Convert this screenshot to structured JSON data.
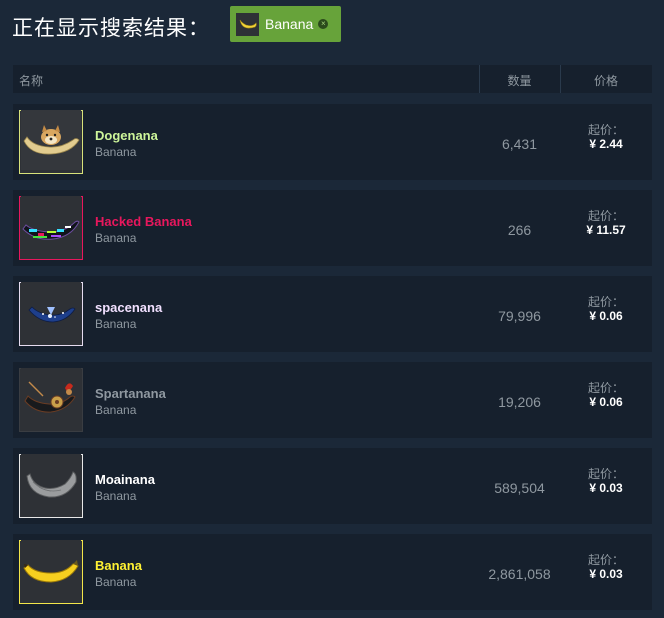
{
  "header": {
    "title": "正在显示搜索结果：",
    "filter_tag": {
      "label": "Banana",
      "close_icon": "close-circle-icon"
    }
  },
  "table": {
    "columns": {
      "name": "名称",
      "quantity": "数量",
      "price": "价格"
    },
    "rows": [
      {
        "name": "Dogenana",
        "game": "Banana",
        "quantity": "6,431",
        "price_label": "起价：",
        "price": "¥ 2.44",
        "name_color": "#cdf59a",
        "border_color": "#d8e27a",
        "icon": "doge-banana-icon"
      },
      {
        "name": "Hacked Banana",
        "game": "Banana",
        "quantity": "266",
        "price_label": "起价：",
        "price": "¥ 11.57",
        "name_color": "#e8175d",
        "border_color": "#e8175d",
        "icon": "glitch-banana-icon"
      },
      {
        "name": "spacenana",
        "game": "Banana",
        "quantity": "79,996",
        "price_label": "起价：",
        "price": "¥ 0.06",
        "name_color": "#f1e0ff",
        "border_color": "#e6dcf0",
        "icon": "space-banana-icon"
      },
      {
        "name": "Spartanana",
        "game": "Banana",
        "quantity": "19,206",
        "price_label": "起价：",
        "price": "¥ 0.06",
        "name_color": "#8f98a0",
        "border_color": "#3a3d42",
        "icon": "spartan-banana-icon"
      },
      {
        "name": "Moainana",
        "game": "Banana",
        "quantity": "589,504",
        "price_label": "起价：",
        "price": "¥ 0.03",
        "name_color": "#ffffff",
        "border_color": "#e8e8e8",
        "icon": "stone-banana-icon"
      },
      {
        "name": "Banana",
        "game": "Banana",
        "quantity": "2,861,058",
        "price_label": "起价：",
        "price": "¥ 0.03",
        "name_color": "#fff133",
        "border_color": "#f3e64a",
        "icon": "banana-icon"
      }
    ]
  }
}
